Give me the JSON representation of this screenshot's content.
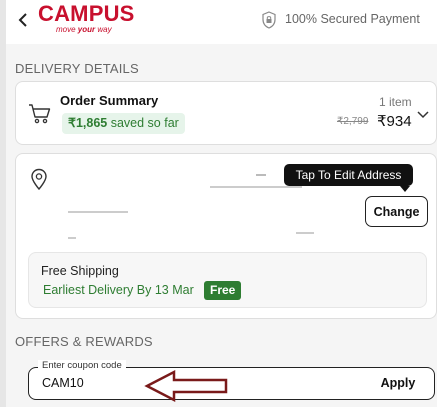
{
  "header": {
    "logo_text": "CAMPUS",
    "logo_tagline_pre": "move ",
    "logo_tagline_bold": "your",
    "logo_tagline_post": " way",
    "secure_text": "100% Secured Payment"
  },
  "delivery_section_title": "DELIVERY DETAILS",
  "order_summary": {
    "title": "Order Summary",
    "saved_amount": "₹1,865",
    "saved_suffix": "saved so far",
    "item_count": "1 item",
    "mrp": "₹2,799",
    "price": "₹934"
  },
  "address": {
    "tooltip": "Tap To Edit Address",
    "change_label": "Change"
  },
  "shipping": {
    "title": "Free Shipping",
    "delivery_text": "Earliest Delivery By 13 Mar",
    "badge": "Free"
  },
  "offers_section_title": "OFFERS & REWARDS",
  "coupon": {
    "label": "Enter coupon code",
    "value": "CAM10",
    "apply_label": "Apply"
  },
  "colors": {
    "brand_red": "#c8102e",
    "success_green": "#2e7d32",
    "annotation_arrow": "#7a1a1a"
  }
}
